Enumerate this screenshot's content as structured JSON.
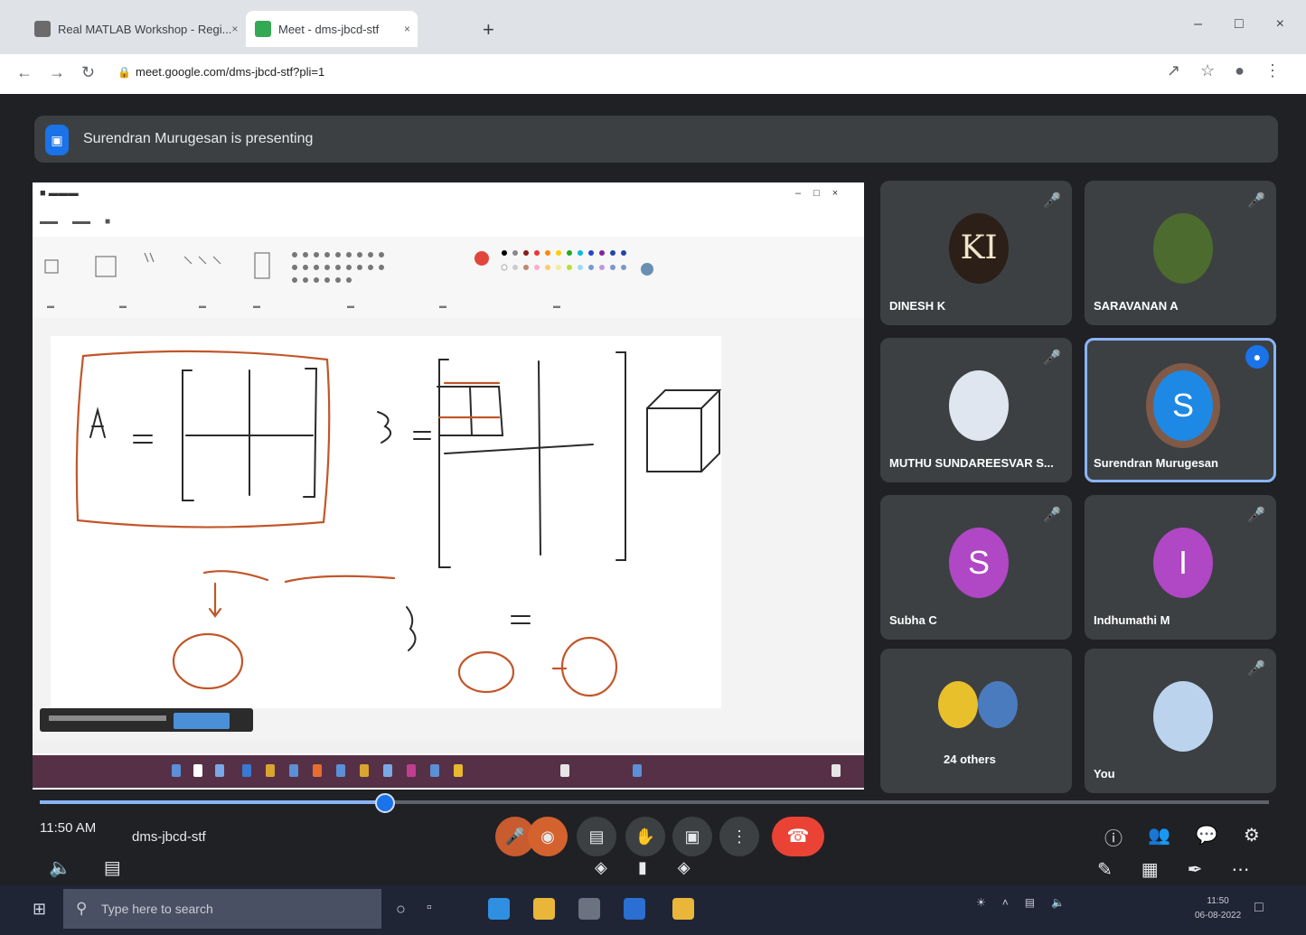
{
  "browser": {
    "tabs": [
      {
        "label": "Real MATLAB Workshop - Regi...",
        "close": "×"
      },
      {
        "label": "Meet - dms-jbcd-stf",
        "close": "×"
      }
    ],
    "new_tab": "+",
    "window_controls": [
      "–",
      "□",
      "×"
    ],
    "url": "meet.google.com/dms-jbcd-stf?pli=1"
  },
  "meet": {
    "presenting_banner": "Surendran Murugesan is presenting",
    "participants": [
      {
        "name": "DINESH K",
        "avatar_text": "KI",
        "avatar_color": "#2b1f17"
      },
      {
        "name": "SARAVANAN A",
        "avatar_text": "",
        "avatar_color": "#4c6b2e"
      },
      {
        "name": "MUTHU SUNDAREESVAR S...",
        "avatar_text": "",
        "avatar_color": "#dfe6ef"
      },
      {
        "name": "Surendran Murugesan",
        "avatar_text": "S",
        "avatar_color": "#1e88e5",
        "speaking": true
      },
      {
        "name": "Subha C",
        "avatar_text": "S",
        "avatar_color": "#b047c4"
      },
      {
        "name": "Indhumathi M",
        "avatar_text": "I",
        "avatar_color": "#b047c4"
      },
      {
        "name": "24 others",
        "avatar_text": "",
        "avatar_color": "#e8c02c"
      },
      {
        "name": "You",
        "avatar_text": "",
        "avatar_color": "#bcd3ee"
      }
    ],
    "bottom_bar": {
      "time": "11:50 AM",
      "meeting_code": "dms-jbcd-stf"
    },
    "progress": 0.28
  },
  "taskbar": {
    "search_placeholder": "Type here to search",
    "clock_time": "11:50",
    "clock_date": "06-08-2022"
  },
  "colors": {
    "meet_bg": "#202124",
    "tile_bg": "#3c4043",
    "accent": "#1a73e8",
    "hangup": "#ea4335",
    "ink": "#c2562a"
  }
}
